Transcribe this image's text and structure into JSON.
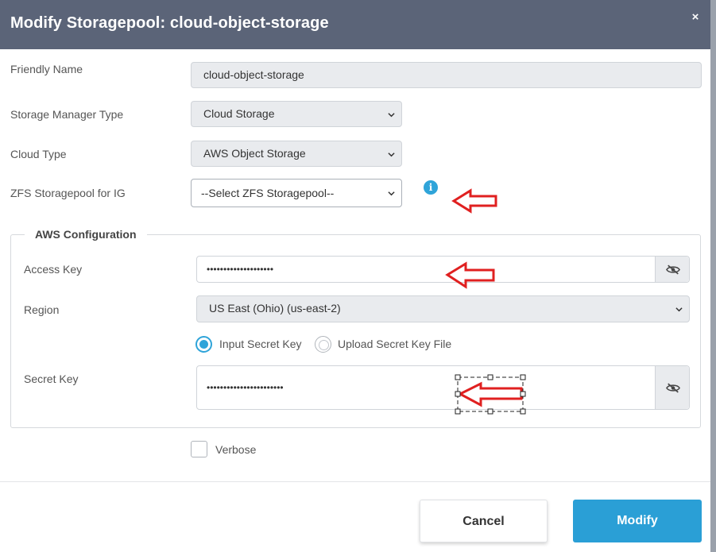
{
  "dialog": {
    "title": "Modify Storagepool: cloud-object-storage",
    "close_symbol": "×"
  },
  "form": {
    "friendly_name": {
      "label": "Friendly Name",
      "value": "cloud-object-storage"
    },
    "storage_manager_type": {
      "label": "Storage Manager Type",
      "value": "Cloud Storage"
    },
    "cloud_type": {
      "label": "Cloud Type",
      "value": "AWS Object Storage"
    },
    "zfs_pool": {
      "label": "ZFS Storagepool for IG",
      "value": "--Select ZFS Storagepool--",
      "info_symbol": "i"
    },
    "aws": {
      "legend": "AWS Configuration",
      "access_key": {
        "label": "Access Key",
        "value": "••••••••••••••••••••"
      },
      "region": {
        "label": "Region",
        "value": "US East (Ohio) (us-east-2)"
      },
      "secret_mode": {
        "options": [
          {
            "label": "Input Secret Key",
            "selected": true
          },
          {
            "label": "Upload Secret Key File",
            "selected": false
          }
        ]
      },
      "secret_key": {
        "label": "Secret Key",
        "value": "•••••••••••••••••••••••"
      }
    },
    "verbose": {
      "label": "Verbose",
      "checked": false
    }
  },
  "footer": {
    "cancel_label": "Cancel",
    "modify_label": "Modify"
  },
  "colors": {
    "header_bg": "#5b6478",
    "accent": "#2a9fd6",
    "annotation_arrow": "#e02020"
  },
  "icons": {
    "close": "close-icon",
    "info": "info-icon",
    "chevron": "chevron-down-icon",
    "eye": "eye-slash-icon"
  }
}
